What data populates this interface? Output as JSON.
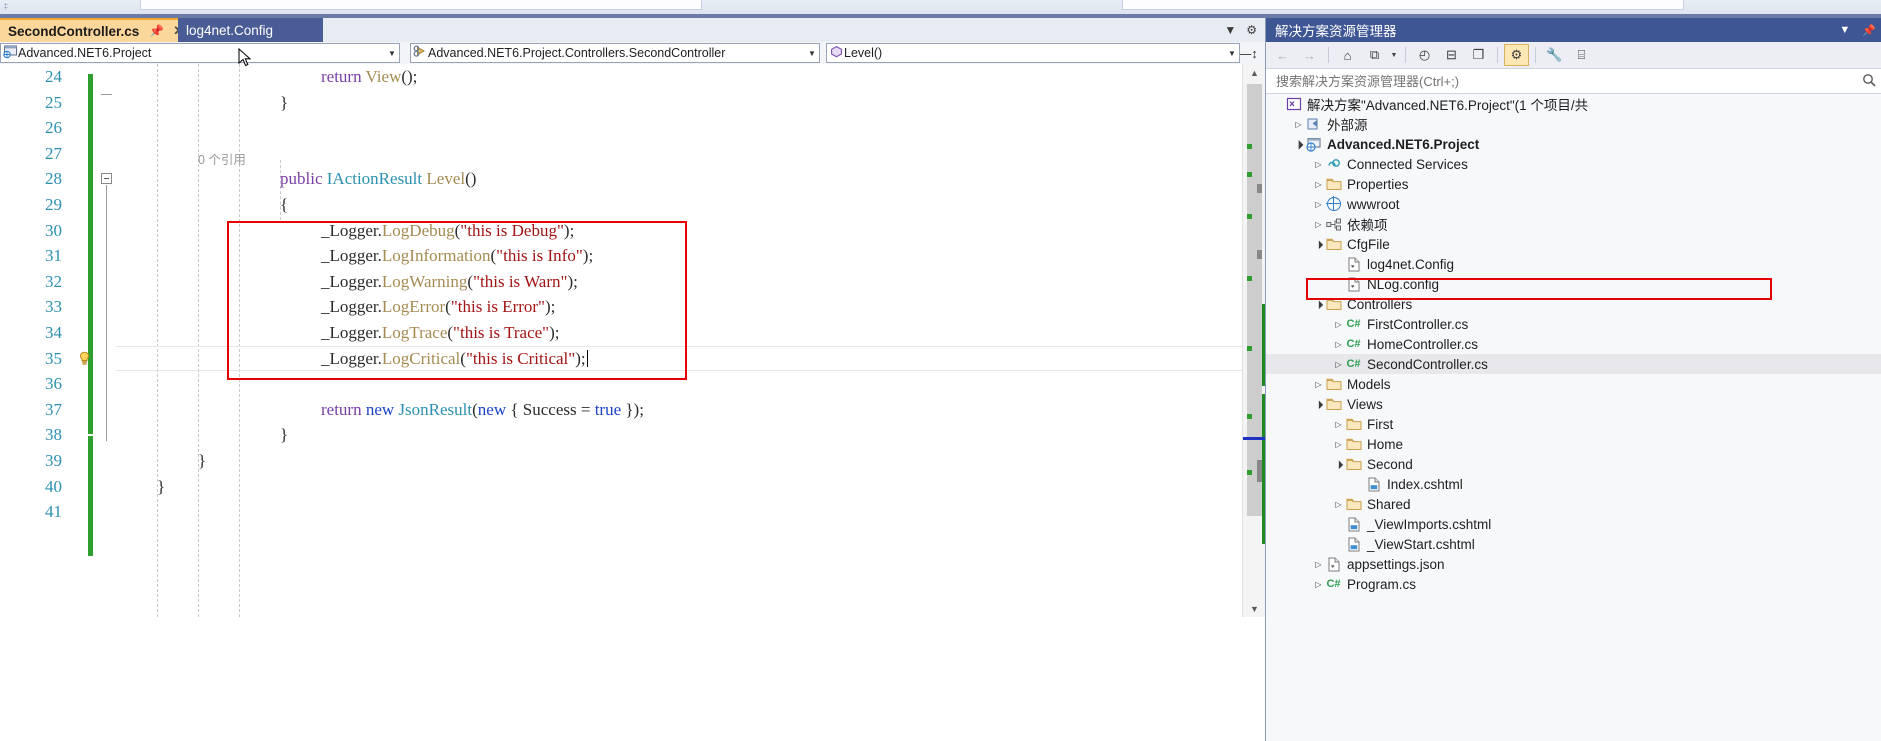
{
  "tabs": {
    "active": {
      "label": "SecondController.cs",
      "pin_icon": "pin-icon",
      "close_icon": "close-icon"
    },
    "inactive": {
      "label": "log4net.Config"
    },
    "right_icons": {
      "dropdown": "chevron-down-icon",
      "settings": "gear-icon"
    }
  },
  "navbar": {
    "project": {
      "value": "Advanced.NET6.Project",
      "icon": "project-icon"
    },
    "type": {
      "value": "Advanced.NET6.Project.Controllers.SecondController",
      "icon": "class-icon"
    },
    "member": {
      "value": "Level()",
      "icon": "method-icon"
    },
    "splitter_icon": "split-view-icon"
  },
  "editor": {
    "codelens": "0 个引用",
    "lines": [
      {
        "num": "24",
        "text": "return View();",
        "indent": 5,
        "kind": "return-view"
      },
      {
        "num": "25",
        "text": "}",
        "indent": 4,
        "kind": "brace"
      },
      {
        "num": "26",
        "text": "",
        "indent": 0,
        "kind": "blank"
      },
      {
        "num": "27",
        "text": "",
        "indent": 0,
        "kind": "blank"
      },
      {
        "num": "28",
        "text": "public IActionResult Level()",
        "indent": 4,
        "kind": "signature"
      },
      {
        "num": "29",
        "text": "{",
        "indent": 4,
        "kind": "brace"
      },
      {
        "num": "30",
        "text": "_Logger.LogDebug(\"this is Debug\");",
        "indent": 5,
        "kind": "log"
      },
      {
        "num": "31",
        "text": "_Logger.LogInformation(\"this is Info\");",
        "indent": 5,
        "kind": "log"
      },
      {
        "num": "32",
        "text": "_Logger.LogWarning(\"this is Warn\");",
        "indent": 5,
        "kind": "log"
      },
      {
        "num": "33",
        "text": "_Logger.LogError(\"this is Error\");",
        "indent": 5,
        "kind": "log"
      },
      {
        "num": "34",
        "text": "_Logger.LogTrace(\"this is Trace\");",
        "indent": 5,
        "kind": "log"
      },
      {
        "num": "35",
        "text": "_Logger.LogCritical(\"this is Critical\");",
        "indent": 5,
        "kind": "log-current"
      },
      {
        "num": "36",
        "text": "",
        "indent": 0,
        "kind": "blank"
      },
      {
        "num": "37",
        "text": "return new JsonResult(new { Success = true });",
        "indent": 5,
        "kind": "return-json"
      },
      {
        "num": "38",
        "text": "}",
        "indent": 4,
        "kind": "brace"
      },
      {
        "num": "39",
        "text": "}",
        "indent": 2,
        "kind": "brace"
      },
      {
        "num": "40",
        "text": "}",
        "indent": 1,
        "kind": "brace"
      },
      {
        "num": "41",
        "text": "",
        "indent": 0,
        "kind": "blank"
      }
    ],
    "code_tokens": {
      "line24": [
        {
          "t": "return",
          "c": "k"
        },
        {
          "t": " ",
          "c": "p"
        },
        {
          "t": "View",
          "c": "m"
        },
        {
          "t": "();",
          "c": "p"
        }
      ],
      "line28": [
        {
          "t": "public",
          "c": "k"
        },
        {
          "t": " ",
          "c": "p"
        },
        {
          "t": "IActionResult",
          "c": "t"
        },
        {
          "t": " ",
          "c": "p"
        },
        {
          "t": "Level",
          "c": "m"
        },
        {
          "t": "()",
          "c": "p"
        }
      ],
      "line37": [
        {
          "t": "return",
          "c": "k"
        },
        {
          "t": " ",
          "c": "p"
        },
        {
          "t": "new",
          "c": "kb"
        },
        {
          "t": " ",
          "c": "p"
        },
        {
          "t": "JsonResult",
          "c": "t"
        },
        {
          "t": "(",
          "c": "p"
        },
        {
          "t": "new",
          "c": "kb"
        },
        {
          "t": " { Success = ",
          "c": "p"
        },
        {
          "t": "true",
          "c": "kb"
        },
        {
          "t": " });",
          "c": "p"
        }
      ]
    },
    "log_calls": [
      {
        "obj": "_Logger.",
        "method": "LogDebug",
        "arg": "this is Debug"
      },
      {
        "obj": "_Logger.",
        "method": "LogInformation",
        "arg": "this is Info"
      },
      {
        "obj": "_Logger.",
        "method": "LogWarning",
        "arg": "this is Warn"
      },
      {
        "obj": "_Logger.",
        "method": "LogError",
        "arg": "this is Error"
      },
      {
        "obj": "_Logger.",
        "method": "LogTrace",
        "arg": "this is Trace"
      },
      {
        "obj": "_Logger.",
        "method": "LogCritical",
        "arg": "this is Critical"
      }
    ],
    "lightbulb_icon": "lightbulb-icon",
    "highlight_color": "#e60000"
  },
  "solution_explorer": {
    "title": "解决方案资源管理器",
    "title_icons": {
      "dropdown": "chevron-down-icon",
      "pin": "pin-icon"
    },
    "toolbar": [
      {
        "name": "back-icon",
        "glyph": "←",
        "state": "dim"
      },
      {
        "name": "forward-icon",
        "glyph": "→",
        "state": "dim"
      },
      {
        "name": "home-icon",
        "glyph": "⌂",
        "state": "normal"
      },
      {
        "name": "sync-with-active-document-icon",
        "glyph": "⧉",
        "state": "normal"
      },
      {
        "name": "pending-changes-icon",
        "glyph": "◴",
        "state": "normal"
      },
      {
        "name": "collapse-all-icon",
        "glyph": "⊟",
        "state": "normal"
      },
      {
        "name": "show-all-files-icon",
        "glyph": "❐",
        "state": "normal"
      },
      {
        "name": "view-switch-icon",
        "glyph": "⚙",
        "state": "selected"
      },
      {
        "name": "properties-icon",
        "glyph": "🔧",
        "state": "normal"
      },
      {
        "name": "preview-selected-items-icon",
        "glyph": "⌸",
        "state": "normal"
      }
    ],
    "search": {
      "placeholder": "搜索解决方案资源管理器(Ctrl+;)",
      "value": "",
      "icon": "search-icon"
    },
    "tree": [
      {
        "label": "解决方案\"Advanced.NET6.Project\"(1 个项目/共",
        "depth": 0,
        "expander": "none",
        "icon": "solution-icon",
        "bold": false,
        "selected": false
      },
      {
        "label": "外部源",
        "depth": 1,
        "expander": "collapsed",
        "icon": "external-sources-icon",
        "bold": false,
        "selected": false
      },
      {
        "label": "Advanced.NET6.Project",
        "depth": 1,
        "expander": "expanded",
        "icon": "web-project-icon",
        "bold": true,
        "selected": false
      },
      {
        "label": "Connected Services",
        "depth": 2,
        "expander": "collapsed",
        "icon": "connected-services-icon",
        "bold": false,
        "selected": false
      },
      {
        "label": "Properties",
        "depth": 2,
        "expander": "collapsed",
        "icon": "properties-folder-icon",
        "bold": false,
        "selected": false
      },
      {
        "label": "wwwroot",
        "depth": 2,
        "expander": "collapsed",
        "icon": "globe-icon",
        "bold": false,
        "selected": false
      },
      {
        "label": "依赖项",
        "depth": 2,
        "expander": "collapsed",
        "icon": "dependencies-icon",
        "bold": false,
        "selected": false
      },
      {
        "label": "CfgFile",
        "depth": 2,
        "expander": "expanded",
        "icon": "folder-icon",
        "bold": false,
        "selected": false
      },
      {
        "label": "log4net.Config",
        "depth": 3,
        "expander": "none",
        "icon": "config-file-icon",
        "bold": false,
        "selected": false
      },
      {
        "label": "NLog.config",
        "depth": 3,
        "expander": "none",
        "icon": "config-file-icon",
        "bold": false,
        "selected": false
      },
      {
        "label": "Controllers",
        "depth": 2,
        "expander": "expanded",
        "icon": "folder-icon",
        "bold": false,
        "selected": false
      },
      {
        "label": "FirstController.cs",
        "depth": 3,
        "expander": "collapsed",
        "icon": "csharp-file-icon",
        "bold": false,
        "selected": false
      },
      {
        "label": "HomeController.cs",
        "depth": 3,
        "expander": "collapsed",
        "icon": "csharp-file-icon",
        "bold": false,
        "selected": false
      },
      {
        "label": "SecondController.cs",
        "depth": 3,
        "expander": "collapsed",
        "icon": "csharp-file-icon",
        "bold": false,
        "selected": true
      },
      {
        "label": "Models",
        "depth": 2,
        "expander": "collapsed",
        "icon": "folder-icon",
        "bold": false,
        "selected": false
      },
      {
        "label": "Views",
        "depth": 2,
        "expander": "expanded",
        "icon": "folder-icon",
        "bold": false,
        "selected": false
      },
      {
        "label": "First",
        "depth": 3,
        "expander": "collapsed",
        "icon": "folder-icon",
        "bold": false,
        "selected": false
      },
      {
        "label": "Home",
        "depth": 3,
        "expander": "collapsed",
        "icon": "folder-icon",
        "bold": false,
        "selected": false
      },
      {
        "label": "Second",
        "depth": 3,
        "expander": "expanded",
        "icon": "folder-icon",
        "bold": false,
        "selected": false
      },
      {
        "label": "Index.cshtml",
        "depth": 4,
        "expander": "none",
        "icon": "cshtml-file-icon",
        "bold": false,
        "selected": false
      },
      {
        "label": "Shared",
        "depth": 3,
        "expander": "collapsed",
        "icon": "folder-icon",
        "bold": false,
        "selected": false
      },
      {
        "label": "_ViewImports.cshtml",
        "depth": 3,
        "expander": "none",
        "icon": "cshtml-file-icon",
        "bold": false,
        "selected": false
      },
      {
        "label": "_ViewStart.cshtml",
        "depth": 3,
        "expander": "none",
        "icon": "cshtml-file-icon",
        "bold": false,
        "selected": false
      },
      {
        "label": "appsettings.json",
        "depth": 2,
        "expander": "collapsed",
        "icon": "json-file-icon",
        "bold": false,
        "selected": false
      },
      {
        "label": "Program.cs",
        "depth": 2,
        "expander": "collapsed",
        "icon": "csharp-file-icon",
        "bold": false,
        "selected": false
      }
    ],
    "highlight_color": "#e60000"
  }
}
